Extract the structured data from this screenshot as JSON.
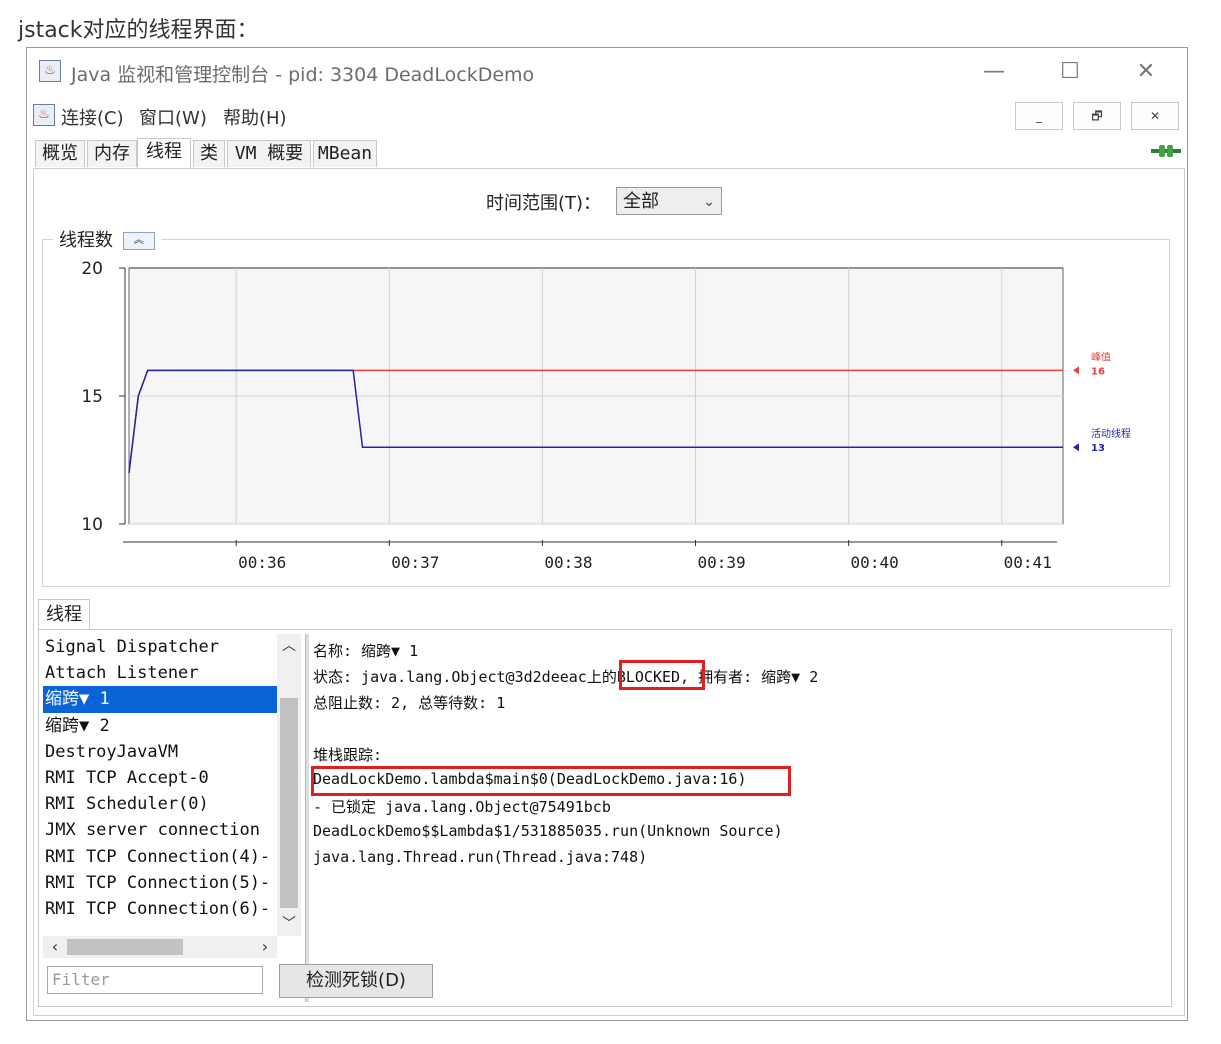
{
  "caption": "jstack对应的线程界面：",
  "window": {
    "title": "Java 监视和管理控制台 - pid: 3304 DeadLockDemo",
    "controls": {
      "minimize": "—",
      "maximize": "☐",
      "close": "✕"
    }
  },
  "menubar": {
    "items": [
      "连接(C)",
      "窗口(W)",
      "帮助(H)"
    ],
    "inner_buttons": {
      "minimize": "_",
      "restore": "🗗",
      "close": "✕"
    }
  },
  "tabs": [
    "概览",
    "内存",
    "线程",
    "类",
    "VM 概要",
    "MBean"
  ],
  "active_tab": "线程",
  "time_range": {
    "label": "时间范围(T)：",
    "value": "全部"
  },
  "chart_data": {
    "type": "line",
    "title": "线程数",
    "x_ticks": [
      "00:36",
      "00:37",
      "00:38",
      "00:39",
      "00:40",
      "00:41"
    ],
    "y_ticks": [
      20,
      15,
      10
    ],
    "ylim": [
      10,
      20
    ],
    "series": [
      {
        "name": "峰值",
        "value_label": "16",
        "color": "#e8413b",
        "points": [
          [
            0.0,
            12
          ],
          [
            0.01,
            15
          ],
          [
            0.02,
            16
          ],
          [
            0.24,
            16
          ],
          [
            0.25,
            16
          ],
          [
            1.0,
            16
          ]
        ]
      },
      {
        "name": "活动线程",
        "value_label": "13",
        "color": "#2424a8",
        "points": [
          [
            0.0,
            12
          ],
          [
            0.01,
            15
          ],
          [
            0.02,
            16
          ],
          [
            0.24,
            16
          ],
          [
            0.25,
            13
          ],
          [
            1.0,
            13
          ]
        ]
      }
    ]
  },
  "threads_tab": "线程",
  "threads": [
    "Signal Dispatcher",
    "Attach Listener",
    "缩跨▼ 1",
    "缩跨▼ 2",
    "DestroyJavaVM",
    "RMI TCP Accept-0",
    "RMI Scheduler(0)",
    "JMX server connection",
    "RMI TCP Connection(4)-",
    "RMI TCP Connection(5)-",
    "RMI TCP Connection(6)-"
  ],
  "selected_thread_index": 2,
  "detail": {
    "name_line": "名称: 缩跨▼ 1",
    "state_prefix": "状态: java.lang.Object@3d2deeac上的",
    "state_value": "BLOCKED,",
    "state_suffix": " 拥有者: 缩跨▼ 2",
    "counts_line": "总阻止数: 2, 总等待数: 1",
    "stack_heading": "堆栈跟踪:",
    "stack": [
      "DeadLockDemo.lambda$main$0(DeadLockDemo.java:16)",
      "   - 已锁定 java.lang.Object@75491bcb",
      "DeadLockDemo$$Lambda$1/531885035.run(Unknown Source)",
      "java.lang.Thread.run(Thread.java:748)"
    ]
  },
  "filter_placeholder": "Filter",
  "detect_button": "检测死锁(D)",
  "colors": {
    "selection": "#0a64d6",
    "highlight_box": "#e02020"
  }
}
